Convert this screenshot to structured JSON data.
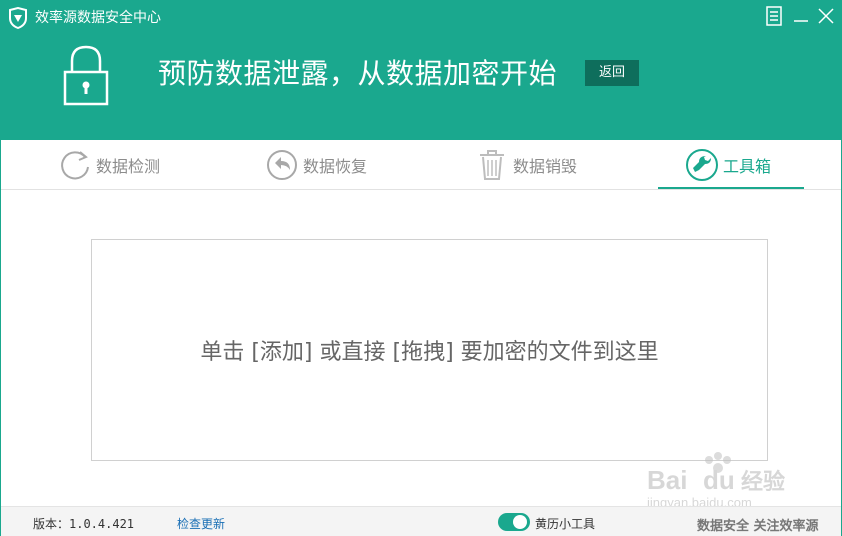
{
  "app": {
    "title": "效率源数据安全中心"
  },
  "header": {
    "slogan": "预防数据泄露，从数据加密开始",
    "back_label": "返回"
  },
  "tabs": [
    {
      "label": "数据检测",
      "icon": "refresh-icon",
      "active": false
    },
    {
      "label": "数据恢复",
      "icon": "undo-icon",
      "active": false
    },
    {
      "label": "数据销毁",
      "icon": "trash-icon",
      "active": false
    },
    {
      "label": "工具箱",
      "icon": "wrench-icon",
      "active": true
    }
  ],
  "main": {
    "drop_text": "单击 [添加] 或直接 [拖拽] 要加密的文件到这里"
  },
  "status": {
    "version": "版本：1.0.4.421",
    "check_update": "检查更新",
    "toggle_label": "黄历小工具",
    "toggle_on": true,
    "footer_note": "数据安全 关注效率源"
  },
  "watermark": {
    "brand": "Baidu经验",
    "url": "jingyan.baidu.com"
  },
  "colors": {
    "primary": "#1aa88e",
    "back_button": "#0e6e5c",
    "link": "#1a6fb5"
  }
}
